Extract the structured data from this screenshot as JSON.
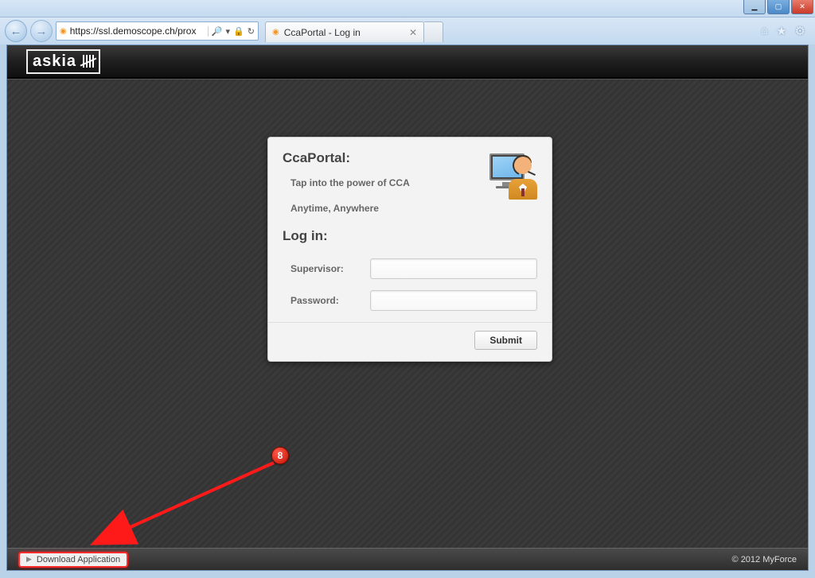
{
  "browser": {
    "url_display": "https://ssl.demoscope.ch/prox",
    "tab_title": "CcaPortal - Log in"
  },
  "header": {
    "logo_text": "askia"
  },
  "login": {
    "title": "CcaPortal:",
    "tagline1": "Tap into the power of CCA",
    "tagline2": "Anytime, Anywhere",
    "login_heading": "Log in:",
    "supervisor_label": "Supervisor:",
    "password_label": "Password:",
    "submit_label": "Submit"
  },
  "footer": {
    "download_label": "Download Application",
    "copyright": "© 2012 MyForce"
  },
  "annotation": {
    "badge_number": "8"
  }
}
